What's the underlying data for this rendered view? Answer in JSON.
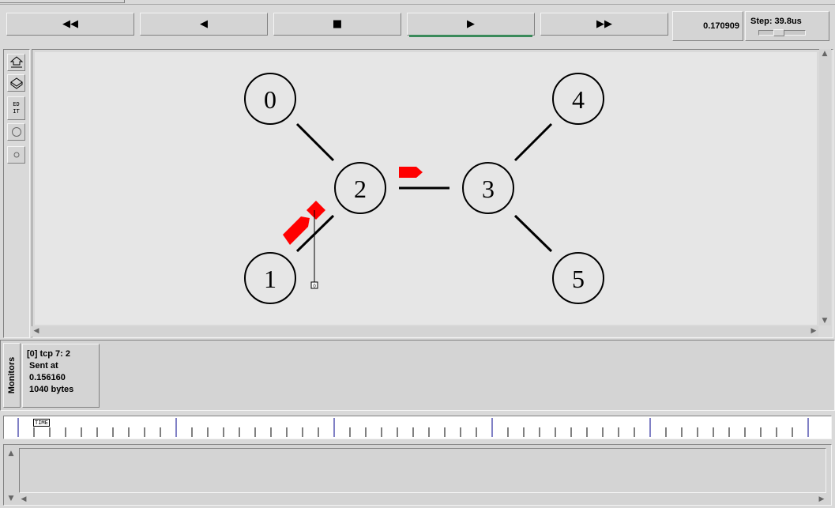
{
  "transport": {
    "rewind_icon": "fast-rewind-icon",
    "back_icon": "step-back-icon",
    "stop_icon": "stop-icon",
    "play_icon": "play-icon",
    "forward_icon": "fast-forward-icon",
    "rewind_glyph": "◀◀",
    "back_glyph": "◀",
    "stop_glyph": "■",
    "play_glyph": "▶",
    "forward_glyph": "▶▶",
    "active_color": "#3a8a5a"
  },
  "time": {
    "current": "0.170909"
  },
  "step": {
    "label": "Step: 39.8us"
  },
  "tools": {
    "edit_label_1": "ED",
    "edit_label_2": "IT"
  },
  "network": {
    "nodes": [
      "0",
      "1",
      "2",
      "3",
      "4",
      "5"
    ],
    "packet_color": "#ff0000",
    "queue_label": "0"
  },
  "monitors": {
    "tab_label": "Monitors",
    "entry_line1": "[0] tcp 7: 2",
    "entry_line2": "Sent at 0.156160",
    "entry_line3": "1040 bytes"
  },
  "timeline": {
    "marker_label": "TIME",
    "major_color": "#00008b"
  }
}
